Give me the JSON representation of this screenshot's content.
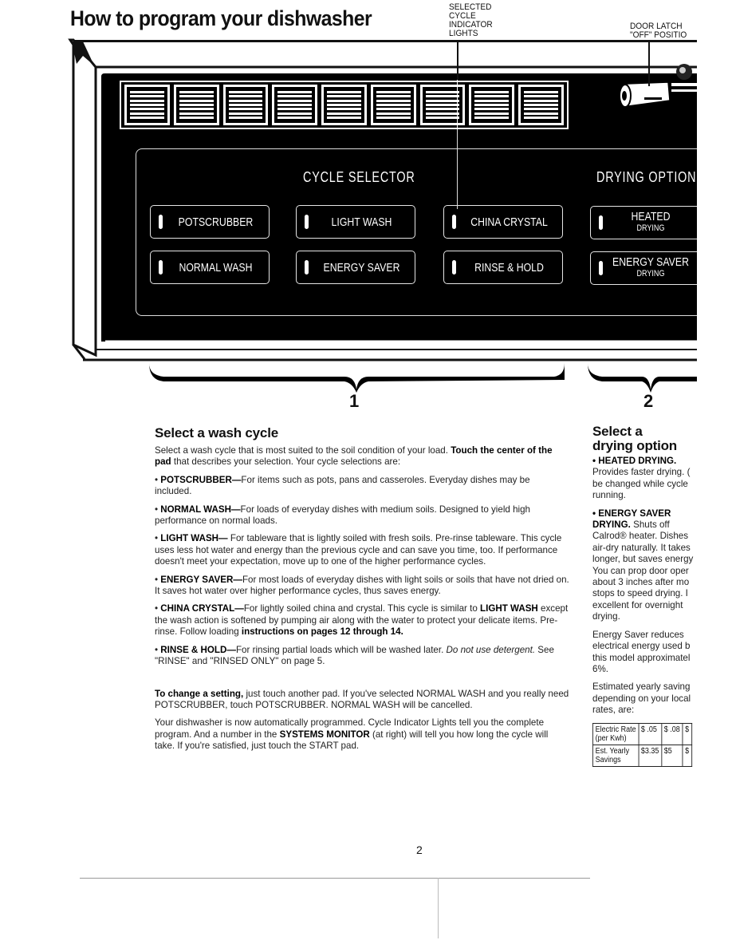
{
  "page": {
    "title": "How to program your dishwasher",
    "page_number": "2"
  },
  "callouts": {
    "indicator_lights": "SELECTED\nCYCLE\nINDICATOR\nLIGHTS",
    "door_latch": "DOOR LATCH\n\"OFF\" POSITIO"
  },
  "panel": {
    "display_digit_count": 9,
    "cycle_selector_label": "CYCLE SELECTOR",
    "drying_options_label": "DRYING OPTION",
    "cycle_pads": [
      {
        "label": "POTSCRUBBER"
      },
      {
        "label": "LIGHT WASH"
      },
      {
        "label": "CHINA CRYSTAL"
      },
      {
        "label": "NORMAL WASH"
      },
      {
        "label": "ENERGY SAVER"
      },
      {
        "label": "RINSE & HOLD"
      }
    ],
    "drying_pads": [
      {
        "label": "HEATED",
        "sub": "DRYING"
      },
      {
        "label": "ENERGY SAVER",
        "sub": "DRYING"
      }
    ],
    "brace_labels": [
      "1",
      "2"
    ]
  },
  "wash_section": {
    "heading": "Select a wash cycle",
    "intro_plain": "Select a wash cycle that is most suited to the soil condition of your load. ",
    "intro_bold": "Touch the center of the pad",
    "intro_rest": " that describes your selection. Your cycle selections are:",
    "items": [
      {
        "name": "POTSCRUBBER—",
        "text": "For items such as pots, pans and casseroles. Everyday dishes may be included."
      },
      {
        "name": "NORMAL WASH—",
        "text": "For loads of everyday dishes with medium soils. Designed to yield high performance on normal loads."
      },
      {
        "name": "LIGHT WASH—",
        "text": " For tableware that is lightly soiled with fresh soils. Pre-rinse tableware. This cycle uses less hot water and energy than the previous cycle and can save you time, too. If performance doesn't meet your expectation, move up to one of the higher performance cycles."
      },
      {
        "name": "ENERGY SAVER—",
        "text": "For most loads of everyday dishes with light soils or soils that have not dried on. It saves hot water over higher performance cycles, thus saves energy."
      }
    ],
    "china": {
      "name": "CHINA CRYSTAL—",
      "text1": "For lightly soiled china and crystal. This cycle is similar to ",
      "bold1": "LIGHT WASH",
      "text2": " except the wash action is softened by pumping air along with the water to protect your delicate items. Pre-rinse. Follow loading ",
      "bold2": "instructions on pages 12 through 14."
    },
    "rinse": {
      "name": "RINSE & HOLD—",
      "text1": "For rinsing partial loads which will be washed later. ",
      "italic": "Do not use detergent.",
      "text2": " See \"RINSE\" and \"RINSED ONLY\" on page 5."
    },
    "change_bold": "To change a setting,",
    "change_text": " just touch another pad. If you've selected NORMAL WASH and you really need POTSCRUBBER, touch POTSCRUBBER. NORMAL WASH will be cancelled.",
    "auto_text1": "Your dishwasher is now automatically programmed. Cycle Indicator Lights tell you the complete program. And a number in the ",
    "auto_bold": "SYSTEMS MONITOR",
    "auto_text2": " (at right) will tell you how long the cycle will take. If you're satisfied, just touch the START pad."
  },
  "drying_section": {
    "heading_line1": "Select a",
    "heading_line2": "drying option",
    "heated_name": "• HEATED DRYING.",
    "heated_lines": [
      "Provides faster drying. (",
      "be changed while cycle",
      "running."
    ],
    "saver_name": "• ENERGY SAVER",
    "saver_name2": "DRYING.",
    "saver_lines_first": " Shuts off",
    "saver_lines": [
      "Calrod® heater. Dishes",
      "air-dry naturally. It takes",
      "longer, but saves energy",
      "You can prop door oper",
      "about 3 inches after mo",
      "stops to speed drying. I",
      "excellent for overnight",
      "drying."
    ],
    "reduces_lines": [
      "Energy Saver reduces",
      "electrical energy used b",
      "this model approximatel",
      "6%."
    ],
    "estimate_lines": [
      "Estimated yearly saving",
      "depending on your local",
      "rates, are:"
    ],
    "savings_table": {
      "row1_label": [
        "Electric Rate",
        "(per Kwh)"
      ],
      "row1_values": [
        "$ .05",
        "$ .08",
        "$"
      ],
      "row2_label": [
        "Est. Yearly",
        "Savings"
      ],
      "row2_values": [
        "$3.35",
        "$5",
        "$"
      ]
    }
  }
}
